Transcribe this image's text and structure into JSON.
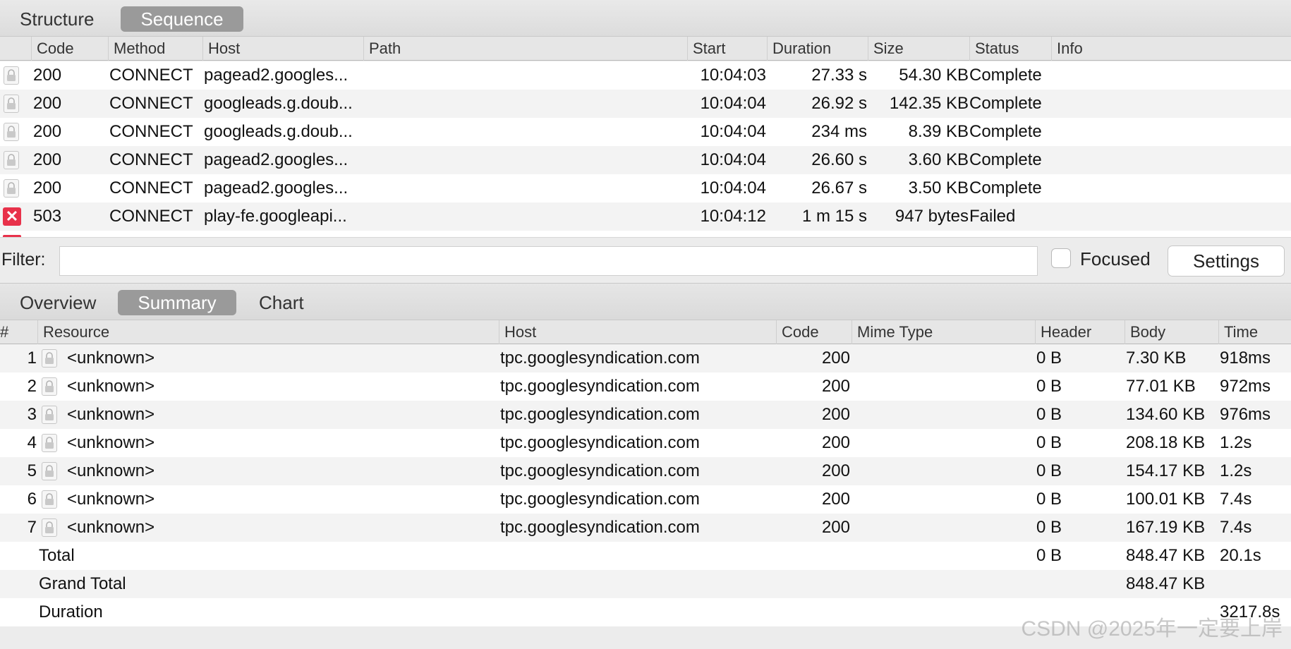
{
  "top_tabs": [
    "Structure",
    "Sequence"
  ],
  "sequence_columns": [
    "Code",
    "Method",
    "Host",
    "Path",
    "Start",
    "Duration",
    "Size",
    "Status",
    "Info"
  ],
  "sequence_rows": [
    {
      "icon": "lock-icon",
      "code": "200",
      "method": "CONNECT",
      "host": "pagead2.googles...",
      "path": "",
      "start": "10:04:03",
      "duration": "27.33 s",
      "size": "54.30 KB",
      "status": "Complete",
      "info": ""
    },
    {
      "icon": "lock-icon",
      "code": "200",
      "method": "CONNECT",
      "host": "googleads.g.doub...",
      "path": "",
      "start": "10:04:04",
      "duration": "26.92 s",
      "size": "142.35 KB",
      "status": "Complete",
      "info": ""
    },
    {
      "icon": "lock-icon",
      "code": "200",
      "method": "CONNECT",
      "host": "googleads.g.doub...",
      "path": "",
      "start": "10:04:04",
      "duration": "234 ms",
      "size": "8.39 KB",
      "status": "Complete",
      "info": ""
    },
    {
      "icon": "lock-icon",
      "code": "200",
      "method": "CONNECT",
      "host": "pagead2.googles...",
      "path": "",
      "start": "10:04:04",
      "duration": "26.60 s",
      "size": "3.60 KB",
      "status": "Complete",
      "info": ""
    },
    {
      "icon": "lock-icon",
      "code": "200",
      "method": "CONNECT",
      "host": "pagead2.googles...",
      "path": "",
      "start": "10:04:04",
      "duration": "26.67 s",
      "size": "3.50 KB",
      "status": "Complete",
      "info": ""
    },
    {
      "icon": "error-icon",
      "code": "503",
      "method": "CONNECT",
      "host": "play-fe.googleapi...",
      "path": "",
      "start": "10:04:12",
      "duration": "1 m 15 s",
      "size": "947 bytes",
      "status": "Failed",
      "info": ""
    }
  ],
  "filter": {
    "label": "Filter:",
    "value": "",
    "focused_label": "Focused",
    "focused_checked": false,
    "settings_label": "Settings"
  },
  "bottom_tabs": [
    "Overview",
    "Summary",
    "Chart"
  ],
  "summary_columns": [
    "#",
    "Resource",
    "Host",
    "Code",
    "Mime Type",
    "Header",
    "Body",
    "Time"
  ],
  "summary_rows": [
    {
      "num": "1",
      "resource": "<unknown>",
      "host": "tpc.googlesyndication.com",
      "code": "200",
      "mime": "",
      "header": "0 B",
      "body": "7.30 KB",
      "time": "918ms"
    },
    {
      "num": "2",
      "resource": "<unknown>",
      "host": "tpc.googlesyndication.com",
      "code": "200",
      "mime": "",
      "header": "0 B",
      "body": "77.01 KB",
      "time": "972ms"
    },
    {
      "num": "3",
      "resource": "<unknown>",
      "host": "tpc.googlesyndication.com",
      "code": "200",
      "mime": "",
      "header": "0 B",
      "body": "134.60 KB",
      "time": "976ms"
    },
    {
      "num": "4",
      "resource": "<unknown>",
      "host": "tpc.googlesyndication.com",
      "code": "200",
      "mime": "",
      "header": "0 B",
      "body": "208.18 KB",
      "time": "1.2s"
    },
    {
      "num": "5",
      "resource": "<unknown>",
      "host": "tpc.googlesyndication.com",
      "code": "200",
      "mime": "",
      "header": "0 B",
      "body": "154.17 KB",
      "time": "1.2s"
    },
    {
      "num": "6",
      "resource": "<unknown>",
      "host": "tpc.googlesyndication.com",
      "code": "200",
      "mime": "",
      "header": "0 B",
      "body": "100.01 KB",
      "time": "7.4s"
    },
    {
      "num": "7",
      "resource": "<unknown>",
      "host": "tpc.googlesyndication.com",
      "code": "200",
      "mime": "",
      "header": "0 B",
      "body": "167.19 KB",
      "time": "7.4s"
    }
  ],
  "totals": {
    "total_label": "Total",
    "total_header": "0 B",
    "total_body": "848.47 KB",
    "total_time": "20.1s",
    "grand_total_label": "Grand Total",
    "grand_total_body": "848.47 KB",
    "duration_label": "Duration",
    "duration_value": "3217.8s"
  },
  "watermark": "CSDN @2025年一定要上岸",
  "colors": {
    "accent_tab": "#9a9a9a",
    "error": "#e8314a"
  }
}
